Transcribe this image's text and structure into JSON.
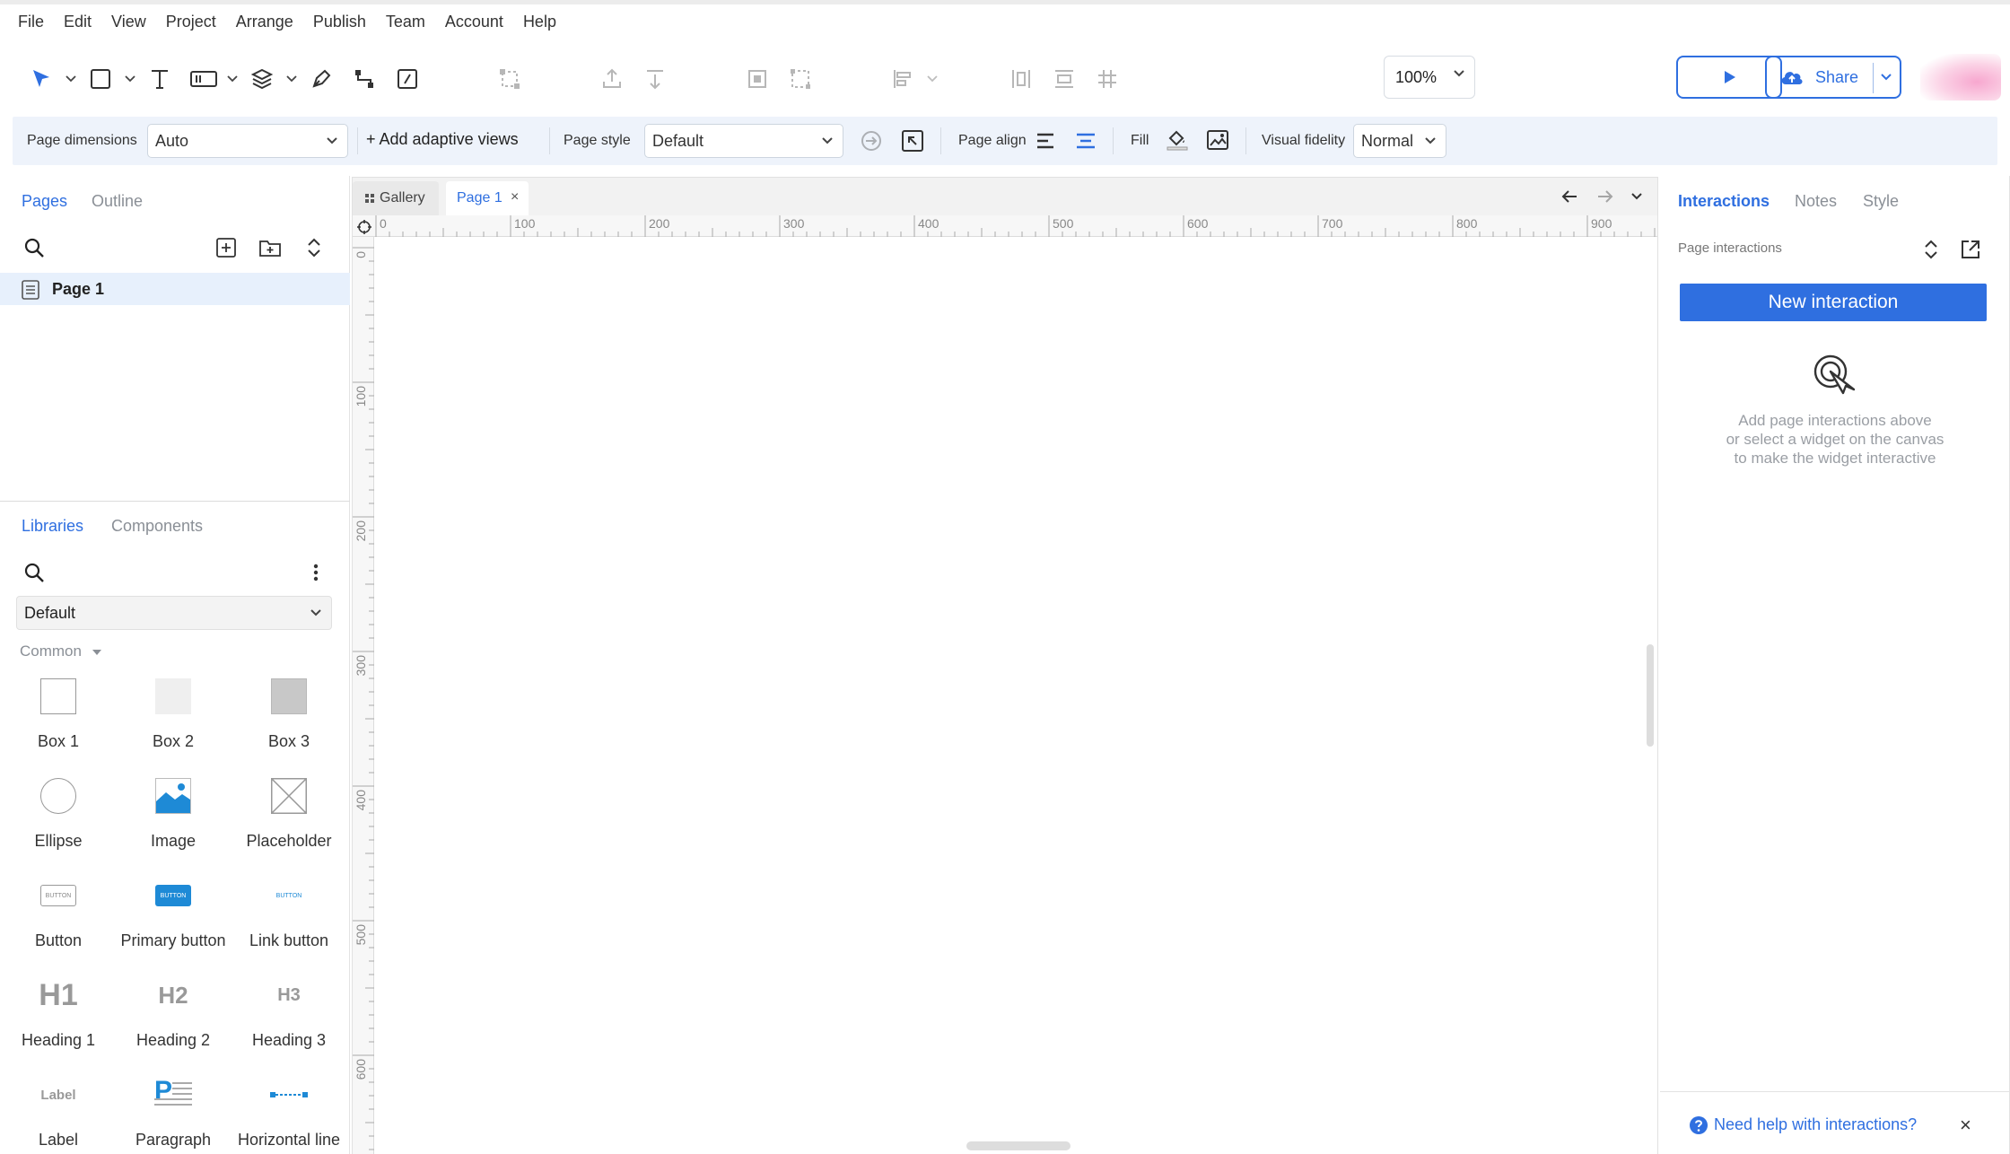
{
  "menu": [
    "File",
    "Edit",
    "View",
    "Project",
    "Arrange",
    "Publish",
    "Team",
    "Account",
    "Help"
  ],
  "toolbar": {
    "zoom": "100%",
    "share_label": "Share",
    "accent": "#2f6fe0"
  },
  "propbar": {
    "page_dimensions_label": "Page dimensions",
    "page_dimensions_value": "Auto",
    "add_adaptive_label": "+ Add adaptive views",
    "page_style_label": "Page style",
    "page_style_value": "Default",
    "page_align_label": "Page align",
    "fill_label": "Fill",
    "visual_fidelity_label": "Visual fidelity",
    "visual_fidelity_value": "Normal"
  },
  "left": {
    "tabs": [
      "Pages",
      "Outline"
    ],
    "pages": [
      "Page 1"
    ],
    "lib_tabs": [
      "Libraries",
      "Components"
    ],
    "library": "Default",
    "section": "Common",
    "widgets": [
      "Box 1",
      "Box 2",
      "Box 3",
      "Ellipse",
      "Image",
      "Placeholder",
      "Button",
      "Primary button",
      "Link button",
      "Heading 1",
      "Heading 2",
      "Heading 3",
      "Label",
      "Paragraph",
      "Horizontal line"
    ],
    "widget_text": {
      "button": "BUTTON",
      "h1": "H1",
      "h2": "H2",
      "h3": "H3",
      "label": "Label",
      "paragraph": "P"
    }
  },
  "canvas": {
    "tabs": {
      "gallery": "Gallery",
      "page": "Page 1",
      "close": "×"
    },
    "ruler_x": [
      "0",
      "100",
      "200",
      "300",
      "400",
      "500",
      "600",
      "700",
      "800",
      "900"
    ],
    "ruler_y": [
      "0",
      "100",
      "200",
      "300",
      "400",
      "500",
      "600"
    ]
  },
  "right": {
    "tabs": [
      "Interactions",
      "Notes",
      "Style"
    ],
    "section_label": "Page interactions",
    "new_interaction": "New interaction",
    "hint_lines": [
      "Add page interactions above",
      "or select a widget on the canvas",
      "to make the widget interactive"
    ],
    "help": "Need help with interactions?",
    "help_close": "×"
  }
}
